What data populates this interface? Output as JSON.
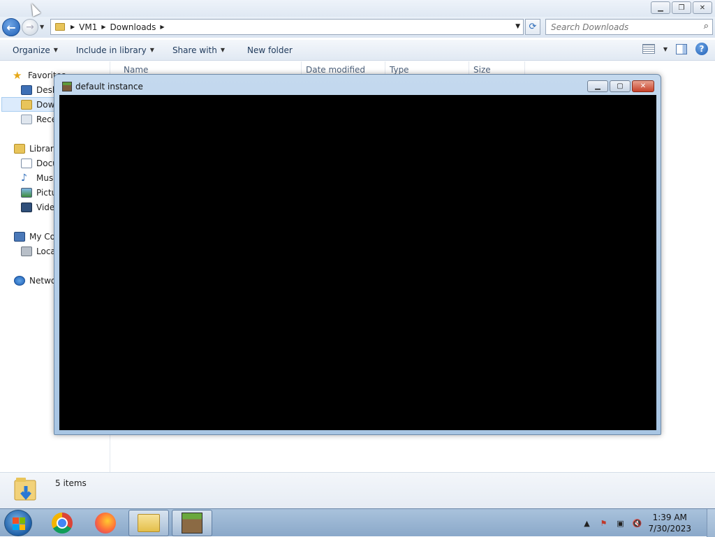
{
  "explorer": {
    "breadcrumb": [
      "VM1",
      "Downloads"
    ],
    "search_placeholder": "Search Downloads",
    "toolbar": {
      "organize": "Organize",
      "include_in_library": "Include in library",
      "share_with": "Share with",
      "new_folder": "New folder"
    },
    "nav_pane": [
      {
        "label": "Favorites",
        "icon": "star-icon"
      },
      {
        "label": "Desktop",
        "icon": "desktop-icon"
      },
      {
        "label": "Downloads",
        "icon": "downloads-folder-icon",
        "selected": true
      },
      {
        "label": "Recent Places",
        "icon": "recent-places-icon"
      },
      {
        "label": "Libraries",
        "icon": "libraries-icon"
      },
      {
        "label": "Documents",
        "icon": "documents-icon"
      },
      {
        "label": "Music",
        "icon": "music-icon"
      },
      {
        "label": "Pictures",
        "icon": "pictures-icon"
      },
      {
        "label": "Videos",
        "icon": "videos-icon"
      },
      {
        "label": "My Computer",
        "icon": "computer-icon"
      },
      {
        "label": "Local Disk",
        "icon": "disk-icon"
      },
      {
        "label": "Network",
        "icon": "network-icon"
      }
    ],
    "columns": [
      "Name",
      "Date modified",
      "Type",
      "Size"
    ],
    "status": "5 items"
  },
  "game_window": {
    "title": "default instance"
  },
  "taskbar": {
    "apps": [
      "chrome-icon",
      "firefox-icon",
      "explorer-icon",
      "minecraft-icon"
    ],
    "clock_time": "1:39 AM",
    "clock_date": "7/30/2023"
  },
  "colors": {
    "selected_bg": "#dcebfc",
    "game_bg": "#000000",
    "taskbar": "#8aa8c9"
  }
}
